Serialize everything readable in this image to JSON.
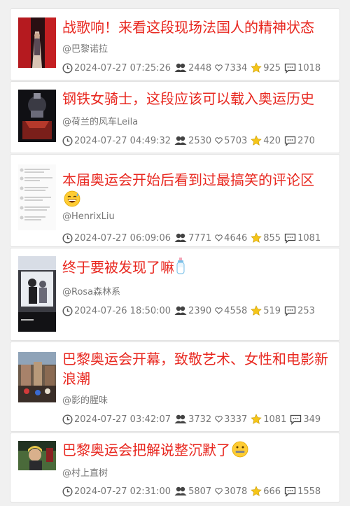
{
  "posts": [
    {
      "title": "战歌响！来看这段现场法国人的精神状态",
      "author": "@巴黎诺拉",
      "time": "2024-07-27 07:25:26",
      "views": "2448",
      "likes": "7334",
      "favorites": "925",
      "comments": "1018",
      "title_emoji": ""
    },
    {
      "title": "钢铁女骑士，这段应该可以载入奥运历史",
      "author": "@荷兰的风车Leila",
      "time": "2024-07-27 04:49:32",
      "views": "2530",
      "likes": "5703",
      "favorites": "420",
      "comments": "270",
      "title_emoji": ""
    },
    {
      "title": "本届奥运会开始后看到过最搞笑的评论区",
      "author": "@HenrixLiu",
      "time": "2024-07-27 06:09:06",
      "views": "7771",
      "likes": "4646",
      "favorites": "855",
      "comments": "1081",
      "title_emoji": "grinning-sweat-emoji"
    },
    {
      "title": "终于要被发现了嘛",
      "author": "@Rosa森林系",
      "time": "2024-07-26 18:50:00",
      "views": "2390",
      "likes": "4558",
      "favorites": "519",
      "comments": "253",
      "title_emoji": "baby-bottle-emoji"
    },
    {
      "title": "巴黎奥运会开幕，致敬艺术、女性和电影新浪潮",
      "author": "@影的腥味",
      "time": "2024-07-27 03:42:07",
      "views": "3732",
      "likes": "3337",
      "favorites": "1081",
      "comments": "349",
      "title_emoji": ""
    },
    {
      "title": "巴黎奥运会把解说整沉默了",
      "author": "@村上直树",
      "time": "2024-07-27 02:31:00",
      "views": "5807",
      "likes": "3078",
      "favorites": "666",
      "comments": "1558",
      "title_emoji": "zipper-mouth-emoji"
    }
  ],
  "colors": {
    "title": "#e8271f",
    "meta": "#777777",
    "star": "#f5c518",
    "card_border": "#e3e3e3"
  }
}
